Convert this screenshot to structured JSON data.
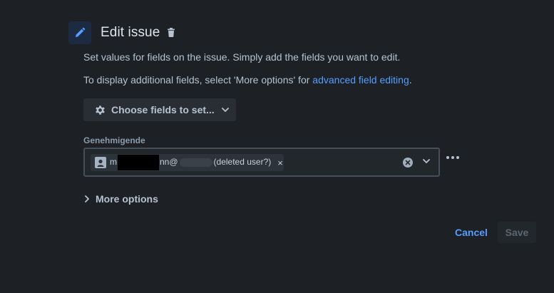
{
  "header": {
    "title": "Edit issue",
    "edit_icon": "pencil-icon",
    "delete_icon": "trash-icon"
  },
  "description": {
    "line1": "Set values for fields on the issue. Simply add the fields you want to edit.",
    "line2_prefix": "To display additional fields, select 'More options' for ",
    "line2_link": "advanced field editing",
    "line2_suffix": "."
  },
  "choose_fields": {
    "label": "Choose fields to set...",
    "icon": "gear-icon"
  },
  "field": {
    "label": "Genehmigende",
    "chip": {
      "prefix": "m",
      "mid": "nn@",
      "suffix": "(deleted user?)",
      "remove": "×"
    }
  },
  "more_options": {
    "label": "More options"
  },
  "footer": {
    "cancel": "Cancel",
    "save": "Save"
  },
  "colors": {
    "background": "#1d2125",
    "accent": "#579dff",
    "text": "#b6c2cf"
  }
}
